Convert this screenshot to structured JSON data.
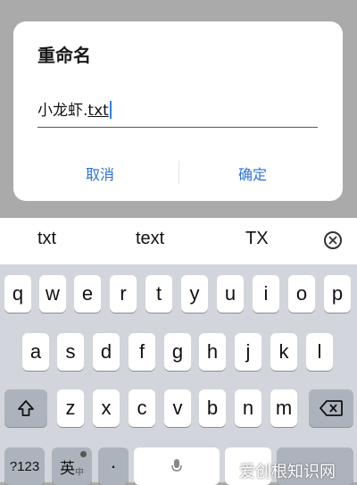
{
  "dialog": {
    "title": "重命名",
    "input_name": "小龙虾.",
    "input_ext": "txt",
    "cancel": "取消",
    "confirm": "确定"
  },
  "suggestions": [
    "txt",
    "text",
    "TX"
  ],
  "keys": {
    "row1": [
      "q",
      "w",
      "e",
      "r",
      "t",
      "y",
      "u",
      "i",
      "o",
      "p"
    ],
    "row2": [
      "a",
      "s",
      "d",
      "f",
      "g",
      "h",
      "j",
      "k",
      "l"
    ],
    "row3": [
      "z",
      "x",
      "c",
      "v",
      "b",
      "n",
      "m"
    ],
    "num_label": "?123",
    "lang_label": "英",
    "lang_sub": "中",
    "dot_label": "·"
  },
  "watermark": "爱创根知识网"
}
